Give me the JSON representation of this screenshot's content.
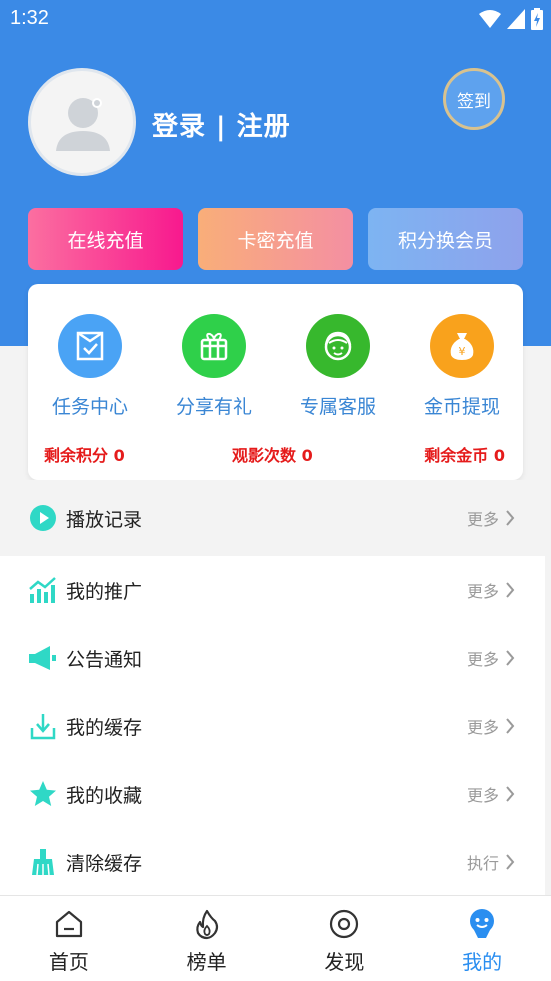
{
  "status": {
    "time": "1:32"
  },
  "profile": {
    "login_register": "登录 | 注册",
    "signin": "签到"
  },
  "actions": [
    "在线充值",
    "卡密充值",
    "积分换会员"
  ],
  "features": [
    {
      "label": "任务中心",
      "icon": "task-icon",
      "color": "#4aa3f5"
    },
    {
      "label": "分享有礼",
      "icon": "gift-icon",
      "color": "#2fd04a"
    },
    {
      "label": "专属客服",
      "icon": "customer-service-icon",
      "color": "#37b82d"
    },
    {
      "label": "金币提现",
      "icon": "money-bag-icon",
      "color": "#f9a21c"
    }
  ],
  "stats": {
    "points": "剩余积分 0",
    "views": "观影次数 0",
    "coins": "剩余金币 0"
  },
  "menu": [
    {
      "label": "播放记录",
      "action": "更多",
      "icon": "play-icon"
    },
    {
      "label": "我的推广",
      "action": "更多",
      "icon": "chart-icon"
    },
    {
      "label": "公告通知",
      "action": "更多",
      "icon": "megaphone-icon"
    },
    {
      "label": "我的缓存",
      "action": "更多",
      "icon": "download-icon"
    },
    {
      "label": "我的收藏",
      "action": "更多",
      "icon": "star-icon"
    },
    {
      "label": "清除缓存",
      "action": "执行",
      "icon": "broom-icon"
    }
  ],
  "tabs": [
    {
      "label": "首页",
      "icon": "home-icon"
    },
    {
      "label": "榜单",
      "icon": "flame-icon"
    },
    {
      "label": "发现",
      "icon": "discover-icon"
    },
    {
      "label": "我的",
      "icon": "profile-icon"
    }
  ],
  "colors": {
    "primary": "#3b8ae6",
    "accent": "#2fd8c6",
    "active_tab": "#2a8ef0",
    "stat_red": "#e51b1b"
  }
}
